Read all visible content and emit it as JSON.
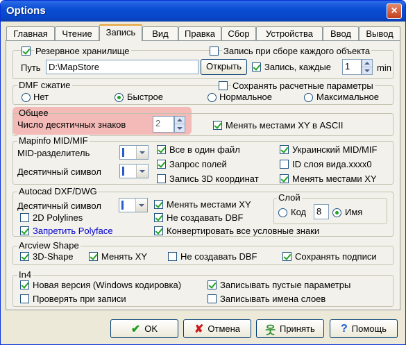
{
  "window": {
    "title": "Options",
    "close_glyph": "×"
  },
  "tabs": [
    {
      "label": "Главная"
    },
    {
      "label": "Чтение"
    },
    {
      "label": "Запись",
      "active": true
    },
    {
      "label": "Вид"
    },
    {
      "label": "Правка"
    },
    {
      "label": "Сбор"
    },
    {
      "label": "Устройства"
    },
    {
      "label": "Ввод"
    },
    {
      "label": "Вывод"
    }
  ],
  "backup": {
    "checkbox_label": "Резервное хранилище",
    "checked": true,
    "save_each_object_label": "Запись при сборе каждого объекта",
    "save_each_object_checked": false,
    "path_label": "Путь",
    "path_value": "D:\\MapStore",
    "open_button": "Открыть",
    "write_every_label": "Запись, каждые",
    "write_every_checked": true,
    "interval_value": "1",
    "interval_unit": "min"
  },
  "dmf": {
    "legend": "DMF сжатие",
    "keep_params_label": "Сохранять расчетные параметры",
    "keep_params_checked": false,
    "options": [
      "Нет",
      "Быстрое",
      "Нормальное",
      "Максимальное"
    ],
    "selected": "Быстрое"
  },
  "general": {
    "legend": "Общее",
    "decimals_label": "Число десятичных знаков",
    "decimals_value": "2",
    "swap_xy_ascii_label": "Менять местами XY в ASCII",
    "swap_xy_ascii_checked": true
  },
  "mapinfo": {
    "legend": "Mapinfo MID/MIF",
    "mid_separator_label": "MID-разделитель",
    "decimal_symbol_label": "Десятичный символ",
    "all_in_one_label": "Все в один файл",
    "all_in_one_checked": true,
    "ukr_label": "Украинский MID/MIF",
    "ukr_checked": true,
    "query_fields_label": "Запрос полей",
    "query_fields_checked": true,
    "layer_id_label": "ID слоя вида.xxxx0",
    "layer_id_checked": false,
    "write_3d_label": "Запись 3D координат",
    "write_3d_checked": false,
    "swap_xy_label": "Менять местами XY",
    "swap_xy_checked": true
  },
  "autocad": {
    "legend": "Autocad DXF/DWG",
    "decimal_symbol_label": "Десятичный символ",
    "swap_xy_label": "Менять местами XY",
    "swap_xy_checked": true,
    "polylines_2d_label": "2D Polylines",
    "polylines_2d_checked": false,
    "no_dbf_label": "Не создавать DBF",
    "no_dbf_checked": true,
    "forbid_polyface_label": "Запретить Polyface",
    "forbid_polyface_checked": true,
    "convert_signs_label": "Конвертировать все условные знаки",
    "convert_signs_checked": true,
    "layer_legend": "Слой",
    "code_label": "Код",
    "code_value": "8",
    "name_label": "Имя",
    "layer_selected": "Имя"
  },
  "arcview": {
    "legend": "Arcview Shape",
    "shape_3d_label": "3D-Shape",
    "shape_3d_checked": true,
    "swap_xy_label": "Менять XY",
    "swap_xy_checked": true,
    "no_dbf_label": "Не создавать DBF",
    "no_dbf_checked": false,
    "keep_captions_label": "Сохранять подписи",
    "keep_captions_checked": true
  },
  "in4": {
    "legend": "In4",
    "new_version_label": "Новая версия (Windows кодировка)",
    "new_version_checked": true,
    "check_on_write_label": "Проверять при записи",
    "check_on_write_checked": false,
    "write_empty_label": "Записывать пустые параметры",
    "write_empty_checked": true,
    "write_layer_names_label": "Записывать имена слоев",
    "write_layer_names_checked": false
  },
  "footer": {
    "ok": "OK",
    "cancel": "Отмена",
    "apply": "Принять",
    "help": "Помощь"
  }
}
